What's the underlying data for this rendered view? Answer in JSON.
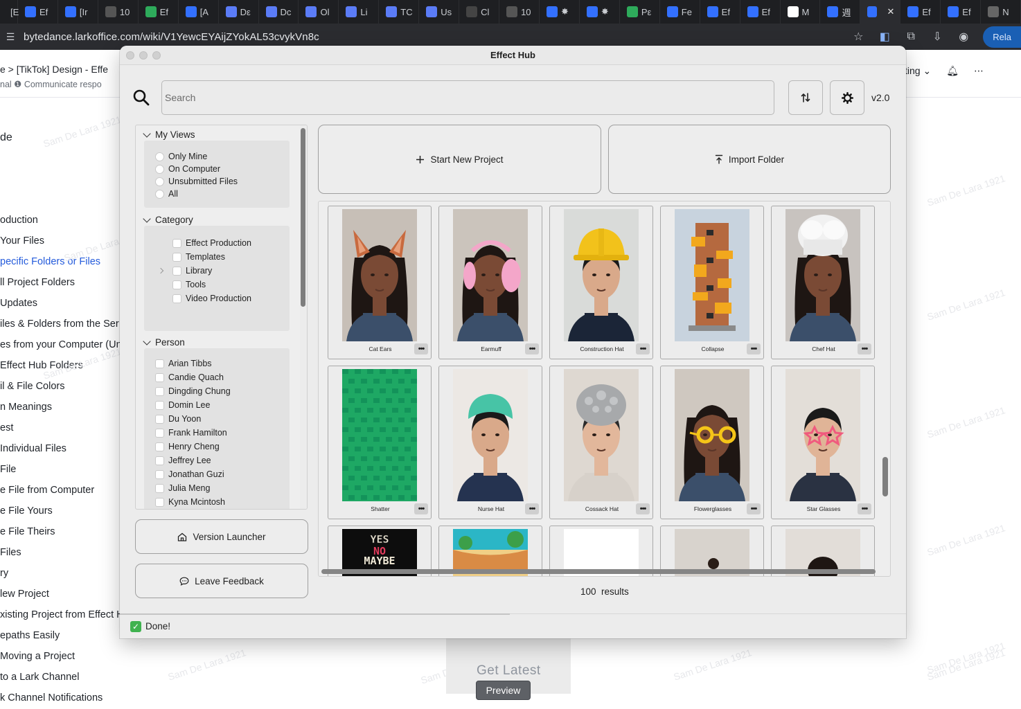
{
  "browser": {
    "tabs": [
      {
        "label": "[E",
        "icon": "doc-icon",
        "color": "#3370ff"
      },
      {
        "label": "Ef",
        "icon": "doc-icon",
        "color": "#3370ff"
      },
      {
        "label": "[Ir",
        "icon": "doc-icon",
        "color": "#3370ff"
      },
      {
        "label": "10",
        "icon": "github-icon",
        "color": "#555555"
      },
      {
        "label": "Ef",
        "icon": "sheet-icon",
        "color": "#2eab5b"
      },
      {
        "label": "[A",
        "icon": "doc-icon",
        "color": "#3370ff"
      },
      {
        "label": "Dε",
        "icon": "cloud-icon",
        "color": "#5b7cf7"
      },
      {
        "label": "Dc",
        "icon": "cloud-icon",
        "color": "#5b7cf7"
      },
      {
        "label": "Ol",
        "icon": "cloud-icon",
        "color": "#5b7cf7"
      },
      {
        "label": "Li",
        "icon": "cloud-icon",
        "color": "#5b7cf7"
      },
      {
        "label": "TC",
        "icon": "cloud-icon",
        "color": "#5b7cf7"
      },
      {
        "label": "Us",
        "icon": "cloud-icon",
        "color": "#5b7cf7"
      },
      {
        "label": "Cl",
        "icon": "openai-icon",
        "color": "#444444"
      },
      {
        "label": "10",
        "icon": "github-icon",
        "color": "#555555"
      },
      {
        "label": "✸",
        "icon": "doc-icon",
        "color": "#3370ff"
      },
      {
        "label": "✸",
        "icon": "doc-icon",
        "color": "#3370ff"
      },
      {
        "label": "Pε",
        "icon": "sheet-icon",
        "color": "#2eab5b"
      },
      {
        "label": "Fe",
        "icon": "people-icon",
        "color": "#3370ff"
      },
      {
        "label": "Ef",
        "icon": "doc-icon",
        "color": "#3370ff"
      },
      {
        "label": "Ef",
        "icon": "doc-icon",
        "color": "#3370ff"
      },
      {
        "label": "M",
        "icon": "w-icon",
        "color": "#ffffff"
      },
      {
        "label": "週",
        "icon": "chart-icon",
        "color": "#3370ff"
      },
      {
        "label": "",
        "icon": "doc-icon",
        "color": "#3370ff",
        "active": true
      },
      {
        "label": "Ef",
        "icon": "doc-icon",
        "color": "#3370ff"
      },
      {
        "label": "Ef",
        "icon": "doc-icon",
        "color": "#3370ff"
      },
      {
        "label": "N",
        "icon": "loading-icon",
        "color": "#666666"
      }
    ],
    "url": "bytedance.larkoffice.com/wiki/V1YewcEYAijZYokAL53cvykVn8c",
    "relaunch_label": "Rela"
  },
  "lark_page": {
    "breadcrumb": "e  >  [TikTok] Design - Effe",
    "breadcrumb_sub": "nal    ❶ Communicate respo",
    "header_right_label": "ting",
    "toc_title": "de",
    "toc_items": [
      "oduction",
      "Your Files",
      "pecific Folders or Files",
      "ll Project Folders",
      "Updates",
      "iles & Folders from the Ser",
      "es from your Computer (Un",
      "Effect Hub Folders",
      "il & File Colors",
      "n Meanings",
      "est",
      " Individual Files",
      "File",
      "e File from Computer",
      "e File Yours",
      "e File Theirs",
      " Files",
      "ry",
      "lew Project",
      "xisting Project from Effect H",
      "epaths Easily",
      " Moving a Project",
      " to a Lark Channel",
      "k Channel Notifications"
    ],
    "toc_active_index": 2,
    "watermark": "Sam De Lara 1921",
    "get_latest": "Get Latest",
    "preview": "Preview"
  },
  "effect_hub": {
    "title": "Effect Hub",
    "search_placeholder": "Search",
    "version": "v2.0",
    "my_views": {
      "title": "My Views",
      "options": [
        "Only Mine",
        "On Computer",
        "Unsubmitted Files",
        "All"
      ]
    },
    "category": {
      "title": "Category",
      "options": [
        "Effect Production",
        "Templates",
        "Library",
        "Tools",
        "Video Production"
      ]
    },
    "person": {
      "title": "Person",
      "options": [
        "Arian Tibbs",
        "Candie Quach",
        "Dingding Chung",
        "Domin Lee",
        "Du Yoon",
        "Frank Hamilton",
        "Henry Cheng",
        "Jeffrey Lee",
        "Jonathan Guzi",
        "Julia Meng",
        "Kyna Mcintosh"
      ]
    },
    "start_new_project": "Start New Project",
    "import_folder": "Import Folder",
    "version_launcher": "Version Launcher",
    "leave_feedback": "Leave Feedback",
    "effects": [
      {
        "name": "Cat Ears",
        "thumb": "cat-ears"
      },
      {
        "name": "Earmuff",
        "thumb": "earmuff"
      },
      {
        "name": "Construction Hat",
        "thumb": "construction-hat"
      },
      {
        "name": "Collapse",
        "thumb": "collapse"
      },
      {
        "name": "Chef Hat",
        "thumb": "chef-hat"
      },
      {
        "name": "Shatter",
        "thumb": "shatter"
      },
      {
        "name": "Nurse Hat",
        "thumb": "nurse-hat"
      },
      {
        "name": "Cossack Hat",
        "thumb": "cossack-hat"
      },
      {
        "name": "Flowerglasses",
        "thumb": "flowerglasses"
      },
      {
        "name": "Star Glasses",
        "thumb": "star-glasses"
      },
      {
        "name": "",
        "thumb": "yes-no-maybe",
        "thumb_text": [
          "YES",
          "NO",
          "MAYBE"
        ]
      },
      {
        "name": "",
        "thumb": "beach"
      },
      {
        "name": "",
        "thumb": "blank"
      },
      {
        "name": "",
        "thumb": "person-small"
      },
      {
        "name": "",
        "thumb": "person-partial"
      }
    ],
    "more_label": "•••",
    "results_count": "100",
    "results_label": "results",
    "status": "Done!"
  }
}
